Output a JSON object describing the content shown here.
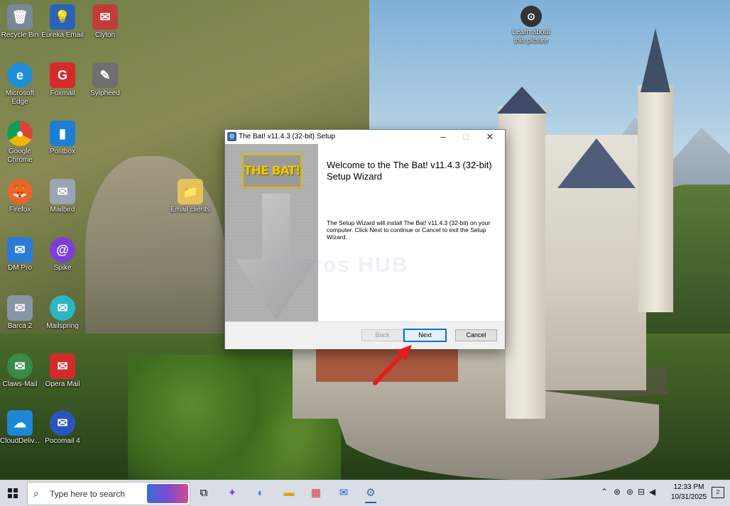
{
  "desktop": {
    "icons": [
      {
        "label": "Recycle Bin",
        "icon": "recycle-bin-icon",
        "color": "#7b8794"
      },
      {
        "label": "Eureka Email",
        "icon": "eureka-email-icon",
        "color": "#2b63b6"
      },
      {
        "label": "Clyton",
        "icon": "mailbox-icon",
        "color": "#c23b3b"
      },
      {
        "label": "Microsoft Edge",
        "icon": "edge-icon",
        "color": "#1f8fd6"
      },
      {
        "label": "Foxmail",
        "icon": "foxmail-icon",
        "color": "#d62a2a"
      },
      {
        "label": "Sylpheed",
        "icon": "sylpheed-icon",
        "color": "#6f6f6f"
      },
      {
        "label": "Google Chrome",
        "icon": "chrome-icon",
        "color": "#e0a500"
      },
      {
        "label": "Postbox",
        "icon": "postbox-icon",
        "color": "#1a7fd4"
      },
      {
        "label": "Email clients",
        "icon": "folder-icon",
        "color": "#e6c35a"
      },
      {
        "label": "Firefox",
        "icon": "firefox-icon",
        "color": "#e8662b"
      },
      {
        "label": "Mailbird",
        "icon": "mailbird-icon",
        "color": "#9aa5b3"
      },
      {
        "label": "DM Pro",
        "icon": "dm-pro-icon",
        "color": "#2a7bd6"
      },
      {
        "label": "Spike",
        "icon": "spike-icon",
        "color": "#7c3fd6"
      },
      {
        "label": "Barca 2",
        "icon": "barca-icon",
        "color": "#8a95a5"
      },
      {
        "label": "Mailspring",
        "icon": "mailspring-icon",
        "color": "#2cb5c5"
      },
      {
        "label": "Claws-Mail",
        "icon": "claws-mail-icon",
        "color": "#3a8a4a"
      },
      {
        "label": "Opera Mail",
        "icon": "opera-mail-icon",
        "color": "#d32a2a"
      },
      {
        "label": "CloudDeliv...",
        "icon": "cloud-delivery-icon",
        "color": "#1e86d6"
      },
      {
        "label": "Pocomail 4",
        "icon": "pocomail-icon",
        "color": "#2a55c0"
      },
      {
        "label": "Learn about this picture",
        "icon": "learn-picture-icon",
        "color": "#333333"
      }
    ]
  },
  "dialog": {
    "title": "The Bat! v11.4.3 (32-bit) Setup",
    "logo_text": "THE BAT!",
    "welcome_title": "Welcome to the The Bat! v11.4.3 (32-bit) Setup Wizard",
    "welcome_text": "The Setup Wizard will install The Bat! v11.4.3 (32-bit) on your computer. Click Next to continue or Cancel to exit the Setup Wizard.",
    "watermark": "AllPros HUB",
    "buttons": {
      "back": "Back",
      "next": "Next",
      "cancel": "Cancel"
    },
    "controls": {
      "minimize": "–",
      "maximize": "□",
      "close": "✕"
    }
  },
  "taskbar": {
    "search_placeholder": "Type here to search",
    "apps": [
      "task-view-icon",
      "copilot-icon",
      "edge-icon",
      "file-explorer-icon",
      "store-icon",
      "outlook-icon",
      "setup-icon"
    ],
    "clock_time": "12:33 PM",
    "clock_date": "10/31/2025",
    "notification_count": "2"
  }
}
